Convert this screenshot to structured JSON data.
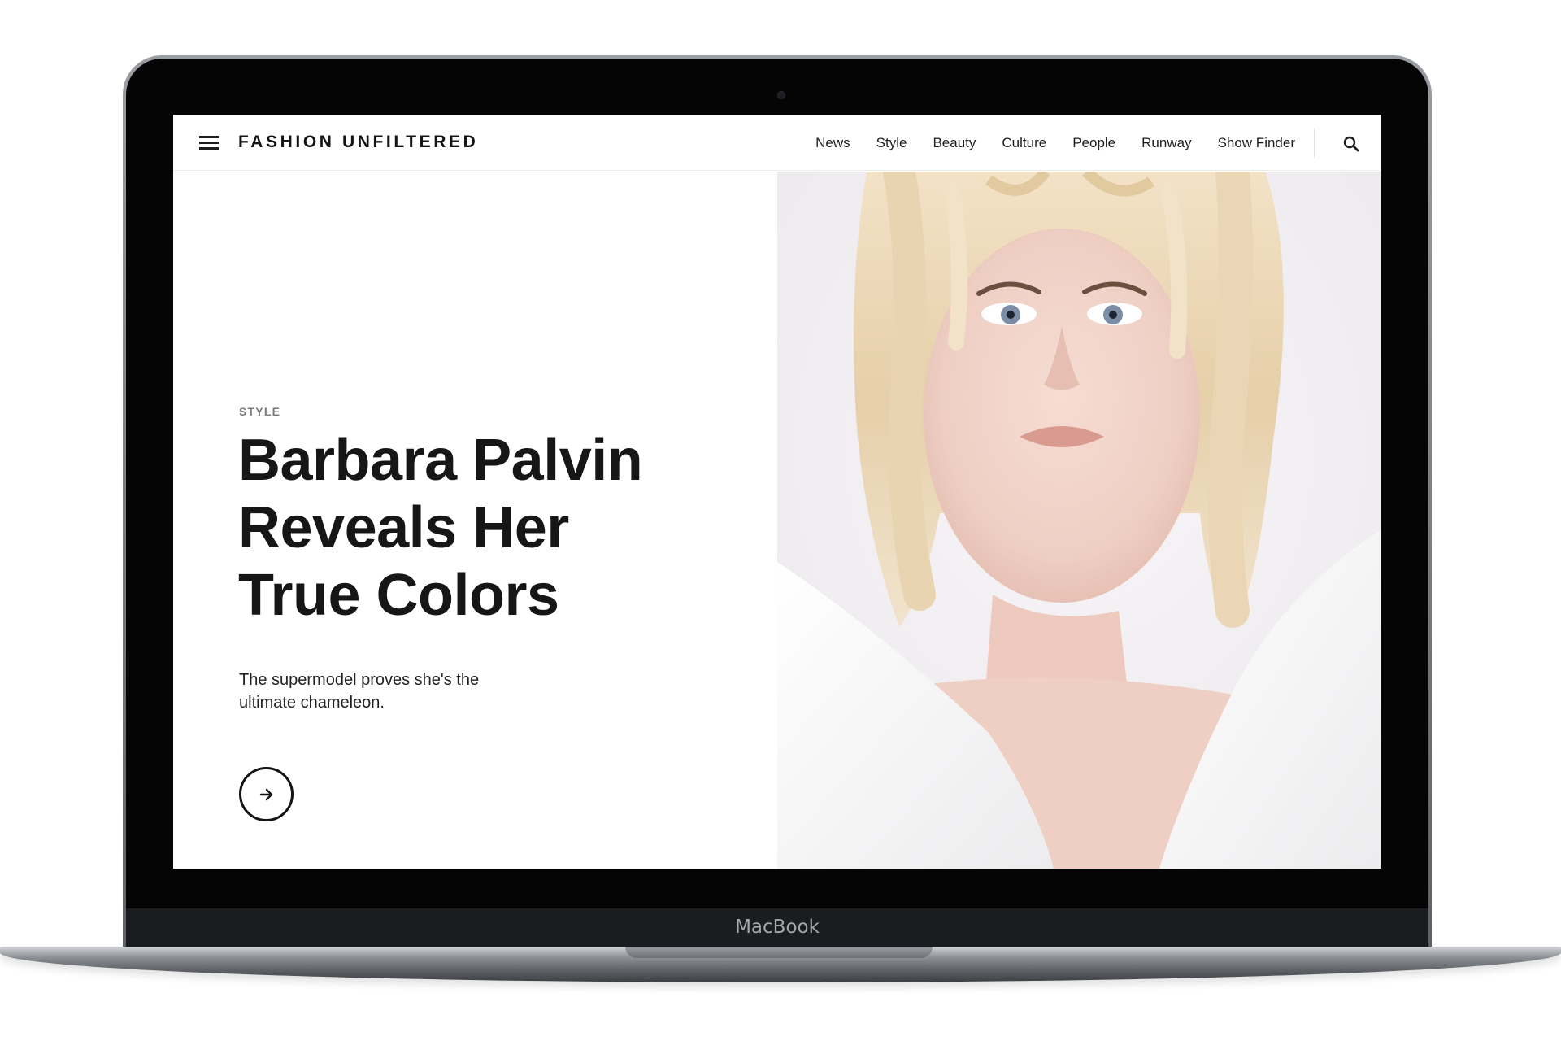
{
  "device": {
    "brand_label": "MacBook"
  },
  "nav": {
    "logo": "FASHION UNFILTERED",
    "links": [
      "News",
      "Style",
      "Beauty",
      "Culture",
      "People",
      "Runway",
      "Show Finder"
    ]
  },
  "hero": {
    "category": "STYLE",
    "headline_lines": [
      "Barbara Palvin",
      "Reveals Her",
      "True Colors"
    ],
    "subhead_lines": [
      "The supermodel proves she's the",
      "ultimate chameleon."
    ]
  },
  "icons": {
    "menu": "hamburger-menu-icon",
    "search": "search-icon",
    "arrow": "arrow-right-icon"
  },
  "colors": {
    "text": "#161616",
    "category": "#7b7b7b",
    "background": "#ffffff"
  }
}
